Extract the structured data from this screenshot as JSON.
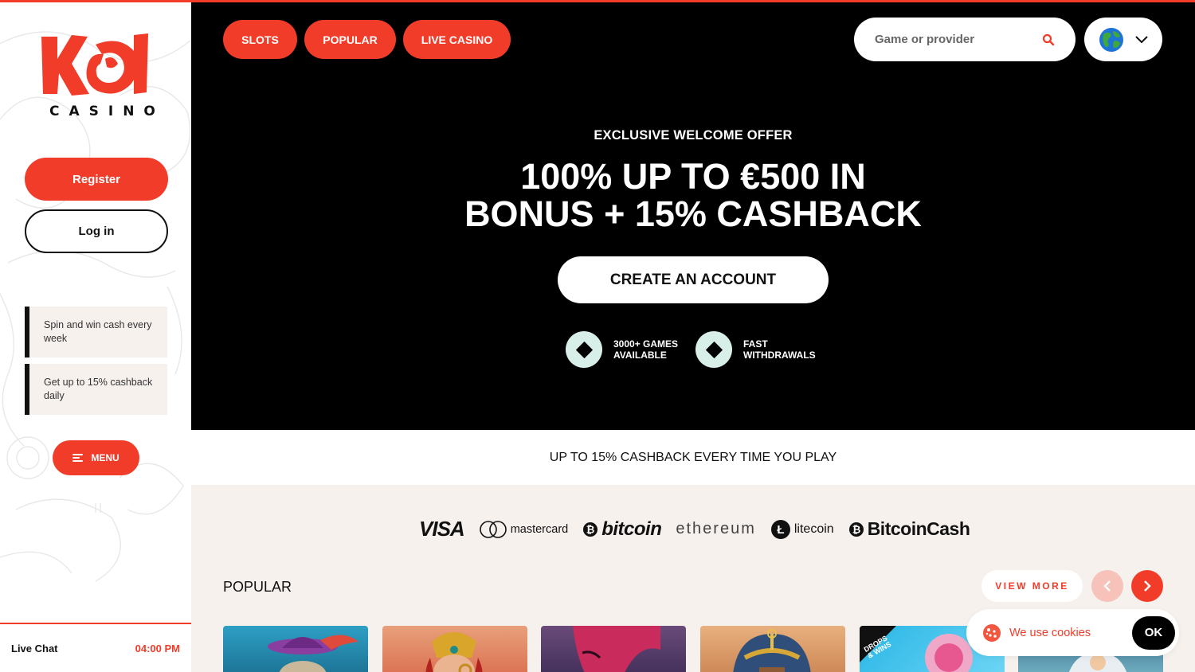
{
  "brand": {
    "logo_text": "KOI",
    "logo_sub": "CASINO",
    "accent": "#f23c2a"
  },
  "sidebar": {
    "register_label": "Register",
    "login_label": "Log in",
    "promos": [
      {
        "text": "Spin and win cash every week"
      },
      {
        "text": "Get up to 15% cashback daily"
      }
    ],
    "menu_label": "MENU",
    "live_chat_label": "Live Chat",
    "time": "04:00 PM"
  },
  "nav": {
    "items": [
      "SLOTS",
      "POPULAR",
      "LIVE CASINO"
    ]
  },
  "search": {
    "placeholder": "Game or provider",
    "icon": "search-icon"
  },
  "language": {
    "icon": "globe-icon"
  },
  "hero": {
    "subtitle": "EXCLUSIVE WELCOME OFFER",
    "title_line1": "100% UP TO €500 IN",
    "title_line2": "BONUS + 15% CASHBACK",
    "cta_label": "CREATE AN ACCOUNT",
    "features": [
      {
        "line1": "3000+ GAMES",
        "line2": "AVAILABLE"
      },
      {
        "line1": "FAST",
        "line2": "WITHDRAWALS"
      }
    ]
  },
  "cashback_banner": "UP TO 15% CASHBACK EVERY TIME YOU PLAY",
  "payments": [
    "VISA",
    "mastercard",
    "bitcoin",
    "ethereum",
    "litecoin",
    "BitcoinCash"
  ],
  "popular": {
    "title": "POPULAR",
    "view_more_label": "VIEW MORE",
    "badge_text": "DROPS & WINS"
  },
  "cookie": {
    "text": "We use cookies",
    "ok_label": "OK"
  }
}
